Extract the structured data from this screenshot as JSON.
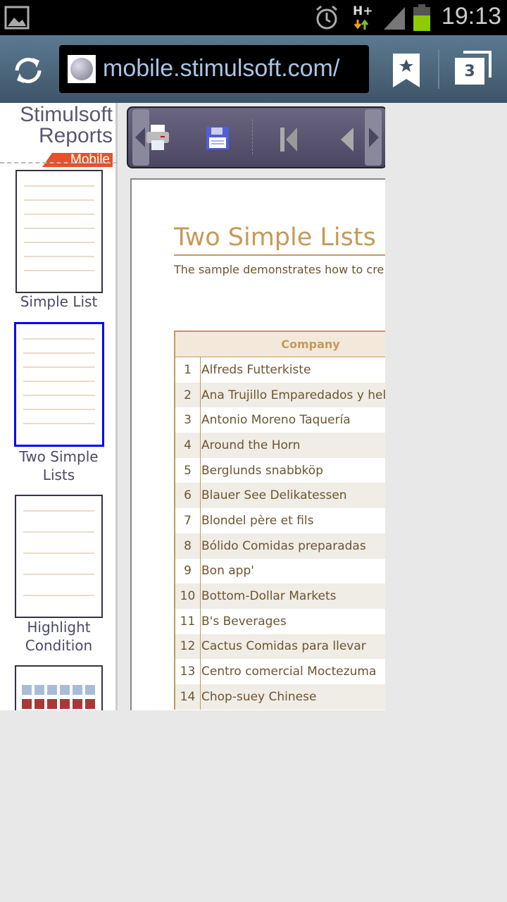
{
  "status_bar": {
    "time": "19:13",
    "network": "H+",
    "icons": [
      "gallery-icon",
      "alarm-icon",
      "network-icon",
      "signal-icon",
      "battery-icon"
    ]
  },
  "browser": {
    "url": "mobile.stimulsoft.com/",
    "tab_count": "3"
  },
  "logo": {
    "line1": "Stimulsoft",
    "line2": "Reports",
    "line3": "Mobile"
  },
  "colors": {
    "accent": "#c49a5a",
    "selected": "#0000ff",
    "logo_badge": "#e8502a"
  },
  "sidebar": {
    "items": [
      {
        "label": "Simple List"
      },
      {
        "label": "Two Simple Lists",
        "selected": true
      },
      {
        "label": "Highlight Condition"
      },
      {
        "label": ""
      }
    ]
  },
  "toolbar": {
    "buttons": [
      "scroll-left",
      "print",
      "save",
      "first-page",
      "previous-page",
      "scroll-right"
    ]
  },
  "report": {
    "title": "Two Simple Lists",
    "subtitle": "The sample demonstrates how to cre",
    "column_header": "Company",
    "rows": [
      {
        "n": "1",
        "company": "Alfreds Futterkiste"
      },
      {
        "n": "2",
        "company": "Ana Trujillo Emparedados y hela"
      },
      {
        "n": "3",
        "company": "Antonio Moreno Taquería"
      },
      {
        "n": "4",
        "company": "Around the Horn"
      },
      {
        "n": "5",
        "company": "Berglunds snabbköp"
      },
      {
        "n": "6",
        "company": "Blauer See Delikatessen"
      },
      {
        "n": "7",
        "company": "Blondel père et fils"
      },
      {
        "n": "8",
        "company": "Bólido Comidas preparadas"
      },
      {
        "n": "9",
        "company": "Bon app'"
      },
      {
        "n": "10",
        "company": "Bottom-Dollar Markets"
      },
      {
        "n": "11",
        "company": "B's Beverages"
      },
      {
        "n": "12",
        "company": "Cactus Comidas para llevar"
      },
      {
        "n": "13",
        "company": "Centro comercial Moctezuma"
      },
      {
        "n": "14",
        "company": "Chop-suey Chinese"
      }
    ]
  }
}
